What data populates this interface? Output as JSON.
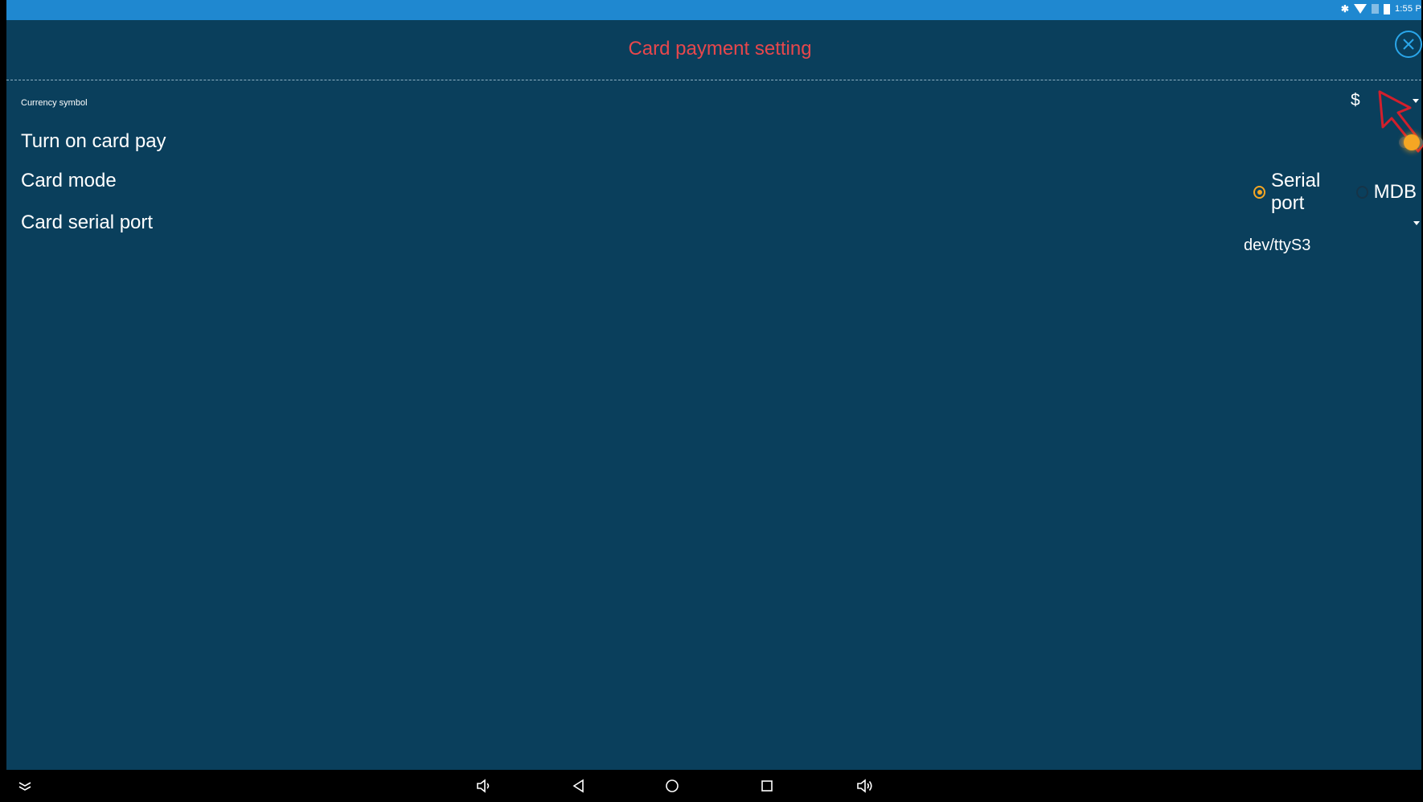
{
  "status_bar": {
    "clock": "1:55 P",
    "icons": [
      "bluetooth-icon",
      "wifi-icon",
      "sim-icon",
      "battery-icon"
    ]
  },
  "header": {
    "title": "Card payment setting",
    "close_icon": "close-icon"
  },
  "settings": {
    "currency_symbol": {
      "label": "Currency symbol",
      "value": "$"
    },
    "card_pay": {
      "label": "Turn on card pay",
      "enabled": true
    },
    "card_mode": {
      "label": "Card mode",
      "options": [
        {
          "label": "Serial port",
          "selected": true
        },
        {
          "label": "MDB",
          "selected": false
        }
      ]
    },
    "card_serial_port": {
      "label": "Card serial port",
      "value": "dev/ttyS3"
    }
  },
  "nav_bar": {
    "icons": [
      "expand-icon",
      "volume-down-icon",
      "back-icon",
      "home-icon",
      "recents-icon",
      "volume-up-icon"
    ]
  },
  "colors": {
    "background": "#0a3f5c",
    "title": "#e7474c",
    "accent": "#f5a623",
    "status_bar": "#1f88d0"
  }
}
